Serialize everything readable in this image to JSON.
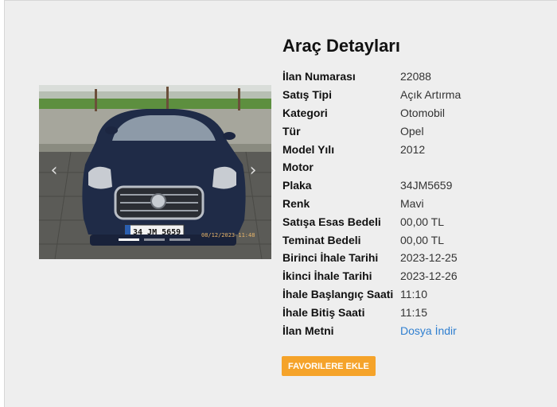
{
  "page": {
    "title": "Araç Detayları"
  },
  "gallery": {
    "prev_icon": "‹",
    "next_icon": "›",
    "indicator_count": 3,
    "active_indicator": 1,
    "timestamp": "08/12/2023 11:48"
  },
  "details": [
    {
      "label": "İlan Numarası",
      "value": "22088"
    },
    {
      "label": "Satış Tipi",
      "value": "Açık Artırma"
    },
    {
      "label": "Kategori",
      "value": "Otomobil"
    },
    {
      "label": "Tür",
      "value": "Opel"
    },
    {
      "label": "Model Yılı",
      "value": "2012"
    },
    {
      "label": "Motor",
      "value": ""
    },
    {
      "label": "Plaka",
      "value": "34JM5659"
    },
    {
      "label": "Renk",
      "value": "Mavi"
    },
    {
      "label": "Satışa Esas Bedeli",
      "value": "00,00 TL"
    },
    {
      "label": "Teminat Bedeli",
      "value": "00,00 TL"
    },
    {
      "label": "Birinci İhale Tarihi",
      "value": "2023-12-25"
    },
    {
      "label": "İkinci İhale Tarihi",
      "value": "2023-12-26"
    },
    {
      "label": "İhale Başlangıç Saati",
      "value": "11:10"
    },
    {
      "label": "İhale Bitiş Saati",
      "value": "11:15"
    },
    {
      "label": "İlan Metni",
      "value": "Dosya İndir",
      "is_link": true
    }
  ],
  "actions": {
    "favorite_label": "FAVORILERE EKLE"
  },
  "colors": {
    "accent": "#f5a32a",
    "link": "#2f7fd0",
    "panel_bg": "#eeeeee"
  }
}
